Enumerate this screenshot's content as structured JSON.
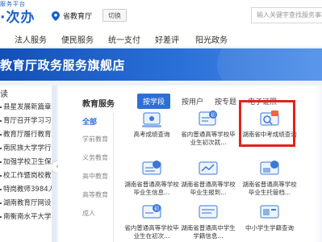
{
  "header": {
    "logo_sub": "服务平台",
    "logo_main": "·次办",
    "location": "省教育厅",
    "switch_label": "切换",
    "search_placeholder": "输入关键字查找服务事项"
  },
  "nav": [
    {
      "label": "法人服务"
    },
    {
      "label": "便民服务"
    },
    {
      "label": "统一支付"
    },
    {
      "label": "好差评"
    },
    {
      "label": "阳光政务"
    }
  ],
  "banner": {
    "title": "教育厅政务服务旗舰店"
  },
  "news": {
    "heading": "读",
    "items": [
      "县星发展新篇章!",
      "育厅召开学习习...",
      "教育厅履行教育职...",
      "南民族大学学行...",
      "加强学校卫生保...",
      "校工作暨岗校教育...",
      "特岗教师3984人",
      "湖南教育厅网设...",
      "南衡南水平大学..."
    ]
  },
  "panel": {
    "title": "教育服务",
    "tabs": [
      {
        "label": "按学段",
        "active": true
      },
      {
        "label": "按用户",
        "active": false
      },
      {
        "label": "按专题",
        "active": false
      },
      {
        "label": "电子证照",
        "active": false
      }
    ],
    "categories": [
      {
        "label": "全部",
        "active": true
      },
      {
        "label": "学前教育",
        "active": false
      },
      {
        "label": "义务教育",
        "active": false
      },
      {
        "label": "高中教育",
        "active": false
      },
      {
        "label": "高等教育",
        "active": false
      },
      {
        "label": "成人",
        "active": false
      }
    ],
    "cards": [
      {
        "label": "高考成绩查询"
      },
      {
        "label": "省内普通高等学校毕业生初次就..."
      },
      {
        "label": "湖南省中考成绩查询"
      },
      {
        "label": "湖南省普通高等学校毕业生信息..."
      },
      {
        "label": "湖南省普通高等学校毕业生报到..."
      },
      {
        "label": "湖南省普通高等学校毕业生托管档..."
      },
      {
        "label": "省内普通高等学校毕业生在初次..."
      },
      {
        "label": "湖南省普通高中学生学籍信息..."
      },
      {
        "label": "中小学生学籍查询"
      }
    ]
  }
}
